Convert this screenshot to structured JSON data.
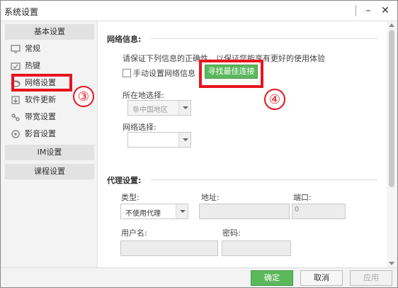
{
  "window": {
    "title": "系统设置",
    "minimize_icon": "minimize-icon",
    "close_icon": "close-icon"
  },
  "sidebar": {
    "section_basic": "基本设置",
    "items": [
      {
        "label": "常规",
        "icon": "monitor-icon"
      },
      {
        "label": "热键",
        "icon": "keyboard-icon"
      },
      {
        "label": "网络设置",
        "icon": "network-icon"
      },
      {
        "label": "软件更新",
        "icon": "update-icon"
      },
      {
        "label": "带宽设置",
        "icon": "bandwidth-icon"
      },
      {
        "label": "影音设置",
        "icon": "media-icon"
      }
    ],
    "section_im": "IM设置",
    "section_course": "课程设置"
  },
  "annotations": {
    "marker3": "③",
    "marker4": "④",
    "highlight_color": "#e8141e"
  },
  "network": {
    "title": "网络信息:",
    "description": "请保证下列信息的正确性，以保证您能享有更好的使用体验",
    "manual_label": "手动设置网络信息",
    "manual_checked": false,
    "find_best_button": "寻找最佳连接",
    "region_label": "所在地选择:",
    "region_value": "非中国地区",
    "network_label": "网络选择:",
    "network_value": ""
  },
  "proxy": {
    "title": "代理设置:",
    "type_label": "类型:",
    "type_value": "不使用代理",
    "address_label": "地址:",
    "address_value": "",
    "port_label": "端口:",
    "port_value": "0",
    "username_label": "用户名:",
    "username_value": "",
    "password_label": "密码:",
    "password_value": ""
  },
  "footer": {
    "ok": "确定",
    "cancel": "取消",
    "apply": "应用"
  },
  "colors": {
    "accent_green": "#5cb85c",
    "annotation_red": "#e8141e"
  }
}
